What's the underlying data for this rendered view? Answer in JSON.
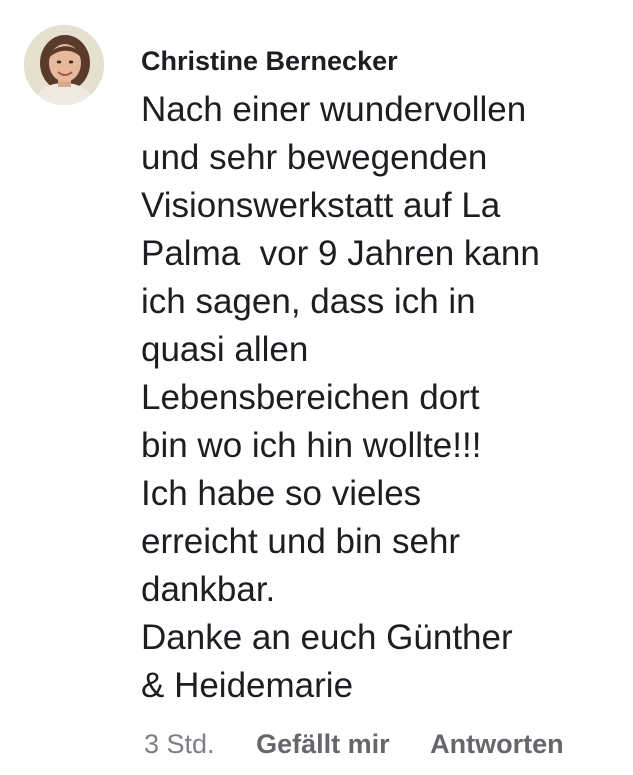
{
  "comment": {
    "author": "Christine Bernecker",
    "avatar_icon": "profile-photo",
    "body_lines": [
      "Nach einer wundervollen",
      "und sehr bewegenden",
      "Visionswerkstatt auf La",
      "Palma  vor 9 Jahren kann",
      "ich sagen, dass ich in",
      "quasi allen",
      "Lebensbereichen dort",
      "bin wo ich hin wollte!!!",
      "Ich habe so vieles",
      "erreicht und bin sehr",
      "dankbar.",
      "Danke an euch Günther",
      "& Heidemarie"
    ],
    "timestamp": "3 Std.",
    "like_label": "Gefällt mir",
    "reply_label": "Antworten"
  },
  "colors": {
    "text": "#1c1e21",
    "meta": "#65676b",
    "background": "#ffffff"
  }
}
